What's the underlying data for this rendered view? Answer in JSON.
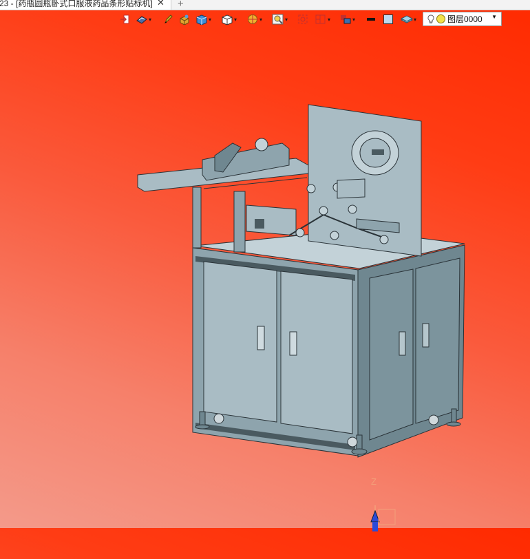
{
  "tab": {
    "title": "23 - [药瓶圆瓶卧式口服液药品条形贴标机]",
    "close_glyph": "✕",
    "new_tab_glyph": "+"
  },
  "toolbar": {
    "items": [
      {
        "name": "exit-sketch-icon",
        "has_dropdown": false
      },
      {
        "name": "render-mode-icon",
        "has_dropdown": true
      },
      {
        "name": "pencil-icon",
        "has_dropdown": false
      },
      {
        "name": "material-icon",
        "has_dropdown": false
      },
      {
        "name": "box-display-icon",
        "has_dropdown": true
      },
      {
        "name": "view-cube-icon",
        "has_dropdown": true
      },
      {
        "name": "section-view-icon",
        "has_dropdown": true
      },
      {
        "name": "zoom-icon",
        "has_dropdown": true
      },
      {
        "name": "zoom-fit-icon",
        "has_dropdown": false
      },
      {
        "name": "layout-icon",
        "has_dropdown": true
      },
      {
        "name": "components-icon",
        "has_dropdown": true
      },
      {
        "name": "line-color-icon",
        "has_dropdown": false
      },
      {
        "name": "fill-color-icon",
        "has_dropdown": false
      },
      {
        "name": "layer-icon",
        "has_dropdown": true
      }
    ]
  },
  "layer_select": {
    "selected": "图层0000"
  },
  "viewport": {
    "background_top": "#ff2a00",
    "background_bottom": "#f49a8a",
    "triad_axis_label": "Z"
  },
  "colors": {
    "machine_front": "#a9bcc4",
    "machine_side": "#6f8790",
    "machine_top": "#c3d2d8",
    "outline": "#2a3338"
  }
}
